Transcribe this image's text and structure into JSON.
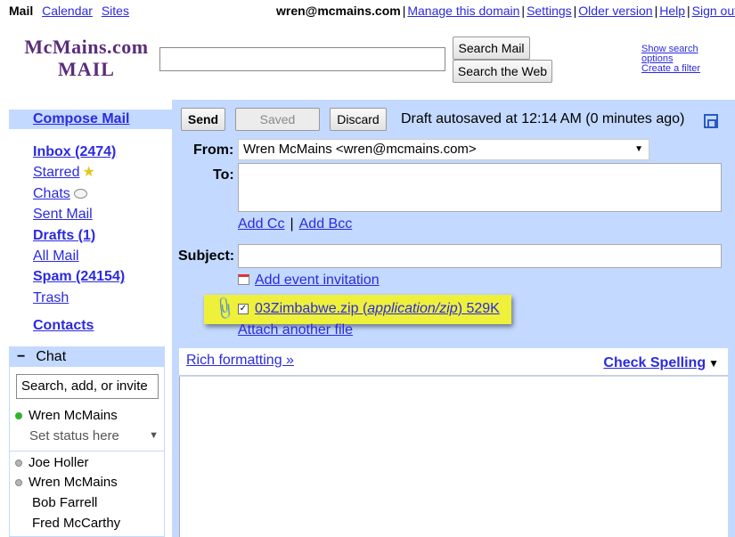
{
  "topnav": {
    "mail": "Mail",
    "calendar": "Calendar",
    "sites": "Sites"
  },
  "toplinks": {
    "email": "wren@mcmains.com",
    "manage": "Manage this domain",
    "settings": "Settings",
    "older": "Older version",
    "help": "Help",
    "signout": "Sign out"
  },
  "logo": {
    "line1": "McMains.com",
    "line2": "MAIL"
  },
  "search": {
    "value": "",
    "search_mail": "Search Mail",
    "search_web": "Search the Web",
    "show_options": "Show search options",
    "show_options_1": "Show search",
    "show_options_2": "options",
    "create_filter": "Create a filter"
  },
  "sidebar": {
    "compose": "Compose Mail",
    "items": [
      {
        "label": "Inbox (2474)"
      },
      {
        "label": "Starred"
      },
      {
        "label": "Chats"
      },
      {
        "label": "Sent Mail"
      },
      {
        "label": "Drafts (1)"
      },
      {
        "label": "All Mail"
      },
      {
        "label": "Spam (24154)"
      },
      {
        "label": "Trash"
      }
    ],
    "contacts": "Contacts"
  },
  "chat": {
    "header": "Chat",
    "minus": "−",
    "search_value": "Search, add, or invite",
    "me": "Wren McMains",
    "status": "Set status here",
    "contacts": [
      "Joe Holler",
      "Wren McMains",
      "Bob Farrell",
      "Fred McCarthy"
    ],
    "online_color": "#2fb32f",
    "idle_color": "#b5b5b5"
  },
  "compose": {
    "send": "Send",
    "saved": "Saved",
    "discard": "Discard",
    "draft_status": "Draft autosaved at 12:14 AM (0 minutes ago)",
    "from_label": "From:",
    "from_value": "Wren McMains <wren@mcmains.com>",
    "to_label": "To:",
    "to_value": "",
    "add_cc": "Add Cc",
    "add_bcc": "Add Bcc",
    "subject_label": "Subject:",
    "subject_value": "",
    "add_event": "Add event invitation",
    "attachment_name": "03Zimbabwe.zip",
    "attachment_type": "application/zip",
    "attachment_size": "529K",
    "attach_another": "Attach another file",
    "rich_formatting": "Rich formatting »",
    "check_spelling": "Check Spelling",
    "body": ""
  },
  "colors": {
    "accent": "#c3d9ff",
    "link": "#2a2adf",
    "highlight": "#eef03a",
    "brand": "#5a2d7a"
  }
}
